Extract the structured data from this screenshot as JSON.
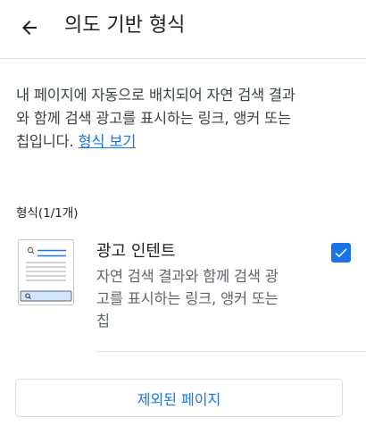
{
  "header": {
    "back_icon": "arrow-back-icon",
    "title": "의도 기반 형식"
  },
  "description": {
    "line1": "내 페이지에 자동으로 배치되어 자연 검색 결과",
    "line2": "와 함께 검색 광고를 표시하는 링크, 앵커 또는",
    "line3_prefix": "칩입니다. ",
    "link_label": "형식 보기"
  },
  "formats": {
    "count_label": "형식(1/1개)",
    "items": [
      {
        "thumbnail_icon": "search-results-thumbnail-icon",
        "title": "광고 인텐트",
        "desc_line1": "자연 검색 결과와 함께 검색 광",
        "desc_line2": "고를 표시하는 링크, 앵커 또는",
        "desc_line3": "칩",
        "checked": true
      }
    ]
  },
  "footer": {
    "excluded_pages_label": "제외된 페이지"
  },
  "colors": {
    "accent": "#1a73e8",
    "divider": "#e0e0e0"
  }
}
